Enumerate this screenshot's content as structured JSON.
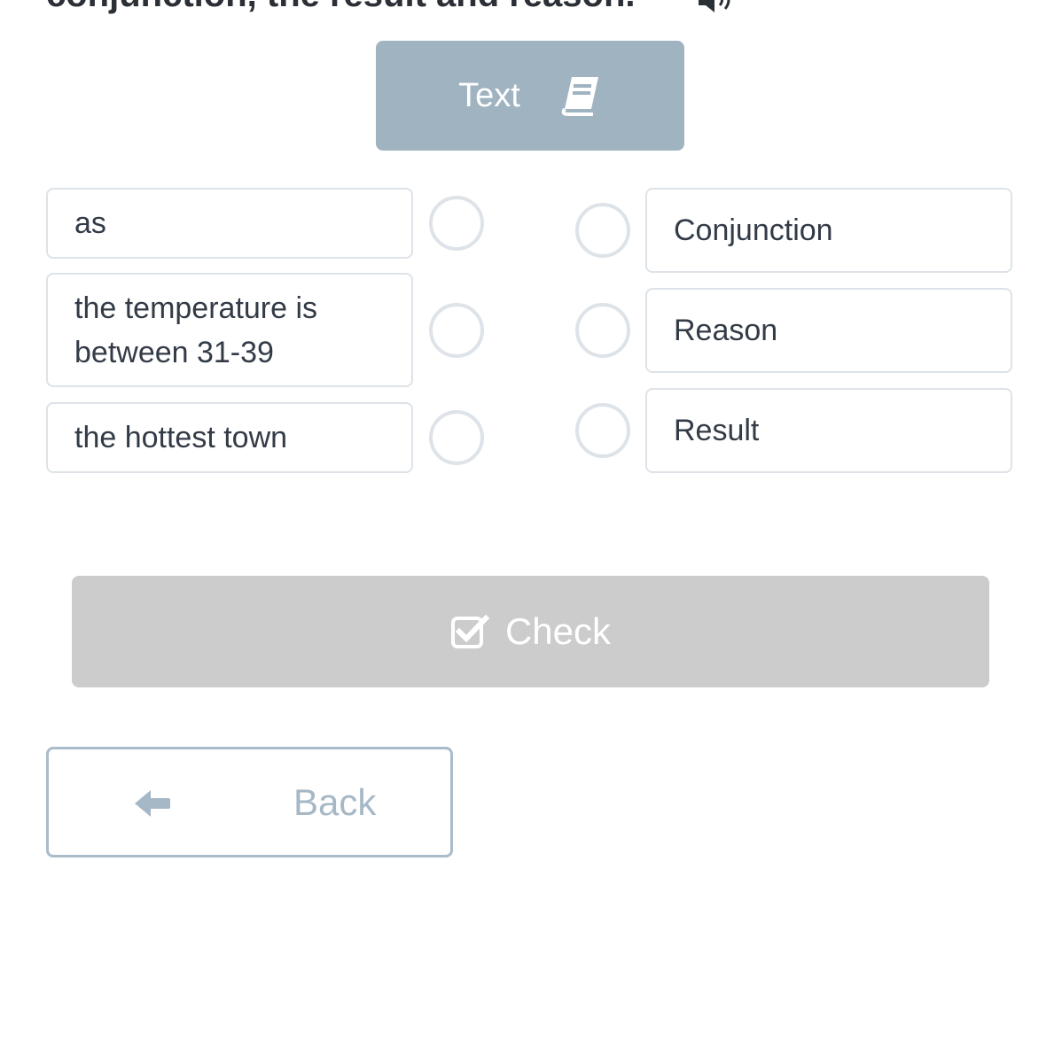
{
  "instruction": "conjunction, the result and reason.",
  "icons": {
    "audio": "speaker-icon",
    "text_button": "book-icon",
    "check": "checkbox-icon",
    "back": "arrow-left-icon"
  },
  "text_button_label": "Text",
  "left_items": [
    "as",
    "the temperature is between 31-39",
    "the hottest town"
  ],
  "right_items": [
    "Conjunction",
    "Reason",
    "Result"
  ],
  "check_button_label": "Check",
  "back_button_label": "Back",
  "colors": {
    "text_button_bg": "#9fb3c1",
    "check_button_bg": "#cccccc",
    "box_border": "#dde3e8",
    "back_border": "#a9bccb"
  }
}
